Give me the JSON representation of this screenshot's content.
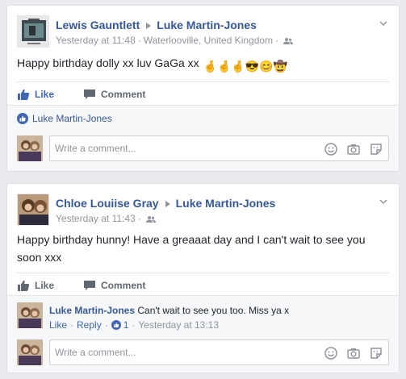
{
  "posts": [
    {
      "author": "Lewis Gauntlett",
      "target": "Luke Martin-Jones",
      "timestamp": "Yesterday at 11:48",
      "location": "Waterlooville, United Kingdom",
      "text": "Happy birthday dolly xx luv GaGa xx",
      "emojis": "🤞🤞🤞😎😊🤠",
      "like_label": "Like",
      "comment_label": "Comment",
      "liked_by": "Luke Martin-Jones",
      "composer_placeholder": "Write a comment..."
    },
    {
      "author": "Chloe Louiise Gray",
      "target": "Luke Martin-Jones",
      "timestamp": "Yesterday at 11:43",
      "text": "Happy birthday hunny! Have a greaaat day and I can't wait to see you soon xxx",
      "like_label": "Like",
      "comment_label": "Comment",
      "comment": {
        "author": "Luke Martin-Jones",
        "text": "Can't wait to see you too. Miss ya x",
        "like_label": "Like",
        "reply_label": "Reply",
        "reaction_count": "1",
        "timestamp": "Yesterday at 13:13"
      },
      "composer_placeholder": "Write a comment..."
    }
  ],
  "colors": {
    "link_blue": "#365899",
    "like_blue": "#4267b2",
    "muted_gray": "#90949c",
    "background": "#e9ebee"
  },
  "icons": [
    "audience-friends-icon",
    "chevron-down-icon",
    "thumbs-up-icon",
    "comment-bubble-icon",
    "emoji-icon",
    "camera-icon",
    "sticker-icon"
  ]
}
